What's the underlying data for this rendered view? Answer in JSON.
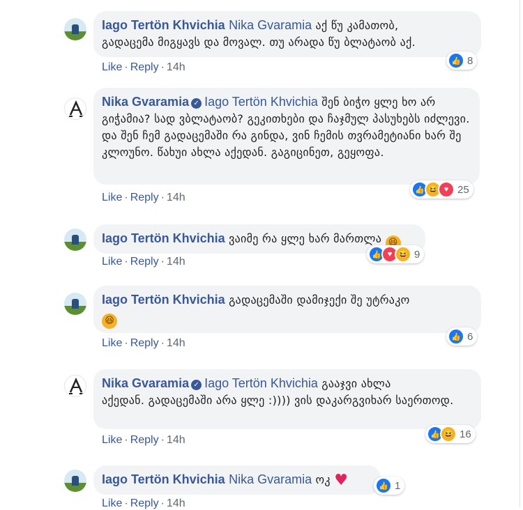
{
  "actions": {
    "like": "Like",
    "reply": "Reply",
    "dot": "·"
  },
  "colors": {
    "link": "#385898",
    "bubble": "#f2f3f5",
    "meta": "#606770",
    "like": "#1877f2",
    "haha": "#f7b125",
    "love": "#f33e58"
  },
  "icons": {
    "like": "👍",
    "haha": "😆",
    "love": "♥",
    "verified": "✓"
  },
  "comments": [
    {
      "author": "Iago Tertön Khvichia",
      "tag": "Nika Gvaramia",
      "text_line1": " აქ წუ კამათობ,",
      "text_rest": "გადაცემა მიგყავს და მოვალ. თუ არადა წუ ბლატაობ აქ.",
      "time": "14h",
      "reactions": [
        "like"
      ],
      "count": "8"
    },
    {
      "author": "Nika Gvaramia",
      "verified": true,
      "tag": "Iago Tertön Khvichia",
      "text_line1": " შენ ბიჭო ყლე ხო არ",
      "text_rest": "გიჭამია? სად ვბლატაობ? გეკითხები და ჩაჯმულ პასუხებს იძლევი. და შენ ჩემ გადაცემაში რა გინდა, ვინ ჩემის თვრამეტიანი ხარ შე კლოუნო. წახუი ახლა აქედან. გაგიცინეთ, გეყოფა.",
      "time": "14h",
      "reactions": [
        "like",
        "haha",
        "love"
      ],
      "count": "25"
    },
    {
      "author": "Iago Tertön Khvichia",
      "text_line1": " ვაიმე რა ყლე ხარ მართლა",
      "emoji": "laugh",
      "time": "14h",
      "reactions": [
        "like",
        "love",
        "haha"
      ],
      "count": "9"
    },
    {
      "author": "Iago Tertön Khvichia",
      "text_line1": " გადაცემაში დამიჯექი შე უტრაკო",
      "emoji_line2": "laugh",
      "time": "14h",
      "reactions": [
        "like"
      ],
      "count": "6"
    },
    {
      "author": "Nika Gvaramia",
      "verified": true,
      "tag": "Iago Tertön Khvichia",
      "text_line1": " გააჯვი ახლა",
      "text_rest": "აქედან. გადაცემაში არა ყლე :)))) ვის დაკარგვიხარ საერთოდ.",
      "time": "14h",
      "reactions": [
        "like",
        "haha"
      ],
      "count": "16"
    },
    {
      "author": "Iago Tertön Khvichia",
      "tag": "Nika Gvaramia",
      "text_line1": " ოკ",
      "emoji": "heart",
      "time": "14h",
      "reactions": [
        "like"
      ],
      "count": "1"
    }
  ]
}
